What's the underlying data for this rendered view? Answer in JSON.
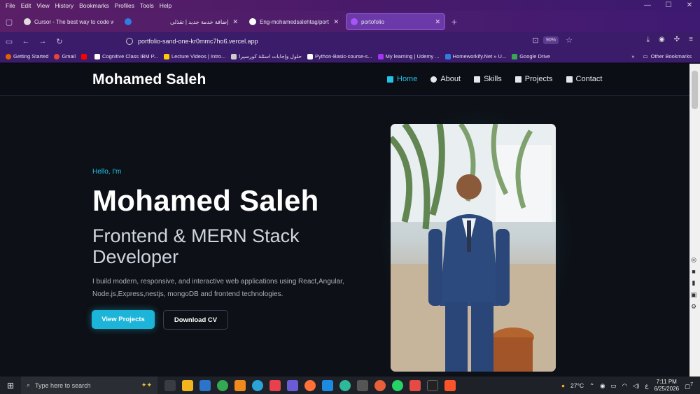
{
  "menubar": {
    "items": [
      "File",
      "Edit",
      "View",
      "History",
      "Bookmarks",
      "Profiles",
      "Tools",
      "Help"
    ]
  },
  "tabs": [
    {
      "label": "Cursor - The best way to code w",
      "active": false
    },
    {
      "label": "",
      "active": false
    },
    {
      "label": "إضافة خدمة جديد | تقذلي",
      "active": false
    },
    {
      "label": "Eng-mohamedsalehtag/portfoli",
      "active": false
    },
    {
      "label": "portofolio",
      "active": true
    }
  ],
  "navbar": {
    "url": "portfolio-sand-one-kr0mmc7ho6.vercel.app",
    "zoom": "90%"
  },
  "bookmarks": [
    {
      "label": "Getting Started",
      "color": "#e66000"
    },
    {
      "label": "Gmail",
      "color": "#ea4335"
    },
    {
      "label": "",
      "color": "#ff0000"
    },
    {
      "label": "Cognitive Class IBM P...",
      "color": "#ffffff"
    },
    {
      "label": "Lecture Videos | Intro...",
      "color": "#ffcc00"
    },
    {
      "label": "حلول وإجابات اسئلة كورسيرا",
      "color": "#cccccc"
    },
    {
      "label": "Python-Basic-course-s...",
      "color": "#ffffff"
    },
    {
      "label": "My learning | Udemy ...",
      "color": "#a435f0"
    },
    {
      "label": "Homeworkify.Net » U...",
      "color": "#2f7de1"
    },
    {
      "label": "Google Drive",
      "color": "#34a853"
    }
  ],
  "bookmarks_other": "Other Bookmarks",
  "site": {
    "brand": "Mohamed Saleh",
    "nav": [
      {
        "label": "Home",
        "active": true
      },
      {
        "label": "About",
        "active": false
      },
      {
        "label": "Skills",
        "active": false
      },
      {
        "label": "Projects",
        "active": false
      },
      {
        "label": "Contact",
        "active": false
      }
    ],
    "hello": "Hello, I'm",
    "name": "Mohamed Saleh",
    "role": "Frontend & MERN Stack Developer",
    "description": "I build modern, responsive, and interactive web applications using React,Angular, Node.js,Express,nestjs, mongoDB and frontend technologies.",
    "primary_button": "View Projects",
    "secondary_button": "Download CV",
    "accent_color": "#22c3e6"
  },
  "taskbar": {
    "search_placeholder": "Type here to search",
    "weather": "27°C",
    "lang": "ع",
    "time": "7:11 PM",
    "date": "6/25/2026",
    "notifications": "7"
  }
}
